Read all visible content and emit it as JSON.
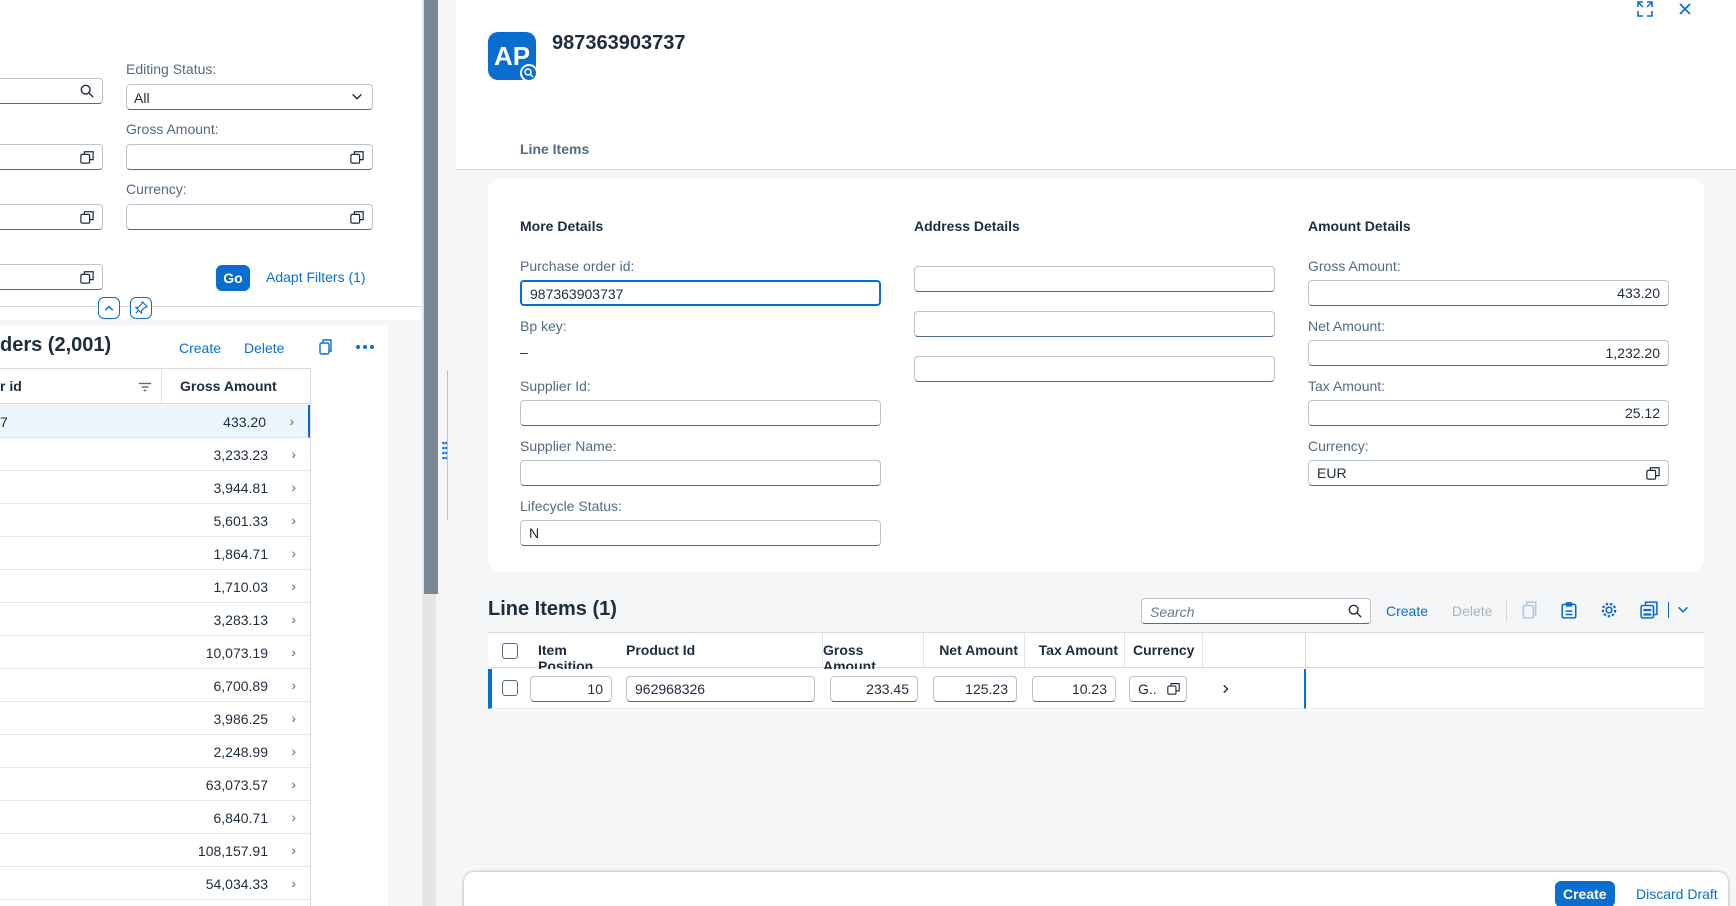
{
  "filters": {
    "editing_status_label": "Editing Status:",
    "editing_status_value": "All",
    "gross_amount_label": "Gross Amount:",
    "currency_label": "Currency:",
    "go_label": "Go",
    "adapt_filters_label": "Adapt Filters (1)"
  },
  "list": {
    "title": "ders (2,001)",
    "create_label": "Create",
    "delete_label": "Delete",
    "col_id": "r id",
    "col_gross": "Gross Amount",
    "rows": [
      {
        "id": "7",
        "amount": "433.20"
      },
      {
        "id": "",
        "amount": "3,233.23"
      },
      {
        "id": "",
        "amount": "3,944.81"
      },
      {
        "id": "",
        "amount": "5,601.33"
      },
      {
        "id": "",
        "amount": "1,864.71"
      },
      {
        "id": "",
        "amount": "1,710.03"
      },
      {
        "id": "",
        "amount": "3,283.13"
      },
      {
        "id": "",
        "amount": "10,073.19"
      },
      {
        "id": "",
        "amount": "6,700.89"
      },
      {
        "id": "",
        "amount": "3,986.25"
      },
      {
        "id": "",
        "amount": "2,248.99"
      },
      {
        "id": "",
        "amount": "63,073.57"
      },
      {
        "id": "",
        "amount": "6,840.71"
      },
      {
        "id": "",
        "amount": "108,157.91"
      },
      {
        "id": "",
        "amount": "54,034.33"
      }
    ]
  },
  "object_page": {
    "title": "987363903737",
    "logo_text": "AP",
    "tab_line_items": "Line Items"
  },
  "more_details": {
    "heading": "More Details",
    "po_id_label": "Purchase order id:",
    "po_id_value": "987363903737",
    "bp_key_label": "Bp key:",
    "bp_key_value": "–",
    "supplier_id_label": "Supplier Id:",
    "supplier_id_value": "",
    "supplier_name_label": "Supplier Name:",
    "supplier_name_value": "",
    "lifecycle_label": "Lifecycle Status:",
    "lifecycle_value": "N"
  },
  "address_details": {
    "heading": "Address Details"
  },
  "amount_details": {
    "heading": "Amount Details",
    "gross_label": "Gross Amount:",
    "gross_value": "433.20",
    "net_label": "Net Amount:",
    "net_value": "1,232.20",
    "tax_label": "Tax Amount:",
    "tax_value": "25.12",
    "currency_label": "Currency:",
    "currency_value": "EUR"
  },
  "line_items": {
    "title": "Line Items (1)",
    "search_placeholder": "Search",
    "create_label": "Create",
    "delete_label": "Delete",
    "columns": {
      "item_position": "Item Position",
      "product_id": "Product Id",
      "gross": "Gross Amount",
      "net": "Net Amount",
      "tax": "Tax Amount",
      "currency": "Currency"
    },
    "row": {
      "item_position": "10",
      "product_id": "962968326",
      "gross": "233.45",
      "net": "125.23",
      "tax": "10.23",
      "currency": "G.."
    }
  },
  "footer": {
    "create_label": "Create",
    "discard_label": "Discard Draft"
  },
  "colors": {
    "accent": "#0a6ed1",
    "text": "#1d2d3e",
    "label": "#556b82"
  }
}
